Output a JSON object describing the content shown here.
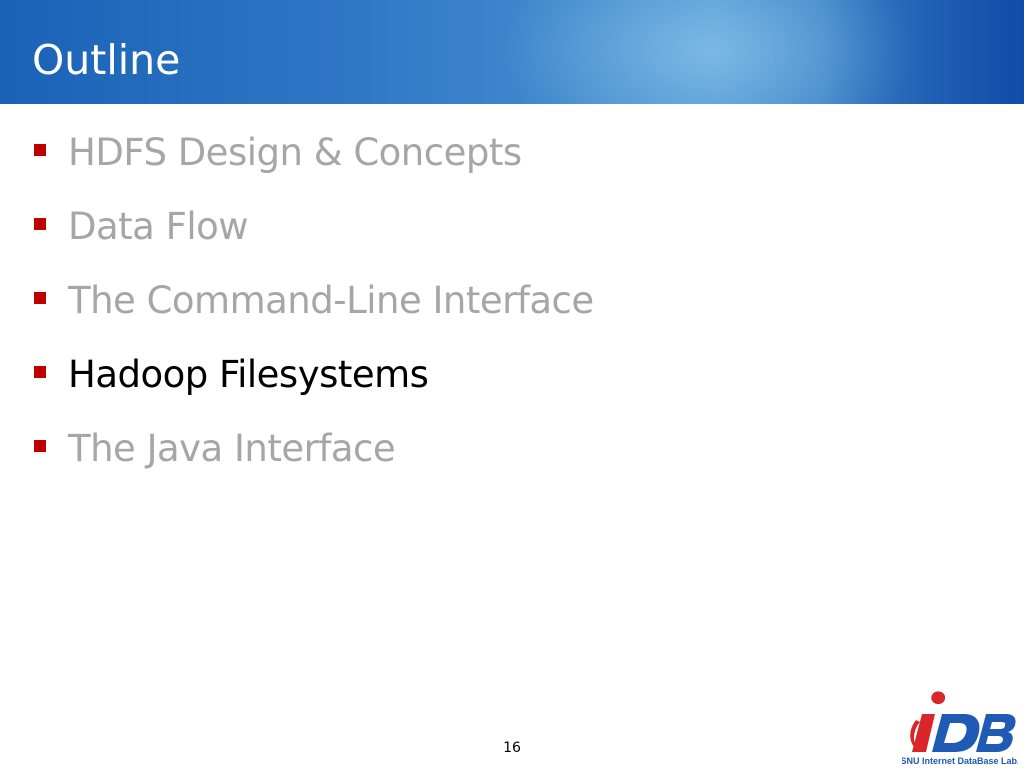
{
  "slide": {
    "title": "Outline",
    "page_number": "16"
  },
  "outline": {
    "items": [
      {
        "label": "HDFS Design & Concepts",
        "state": "muted"
      },
      {
        "label": "Data Flow",
        "state": "muted"
      },
      {
        "label": "The Command-Line Interface",
        "state": "muted"
      },
      {
        "label": "Hadoop Filesystems",
        "state": "current"
      },
      {
        "label": "The Java Interface",
        "state": "muted"
      }
    ]
  },
  "logo": {
    "mark": "iDB",
    "caption": "SNU Internet DataBase Lab."
  },
  "colors": {
    "header_blue": "#2f78c6",
    "bullet_red": "#c00000",
    "muted_text": "#a6a6a6",
    "current_text": "#000000",
    "logo_blue": "#1f5bb5",
    "logo_red": "#d9262b"
  },
  "icons": {
    "bullet": "square-bullet-icon",
    "logo": "idb-logo-icon"
  }
}
